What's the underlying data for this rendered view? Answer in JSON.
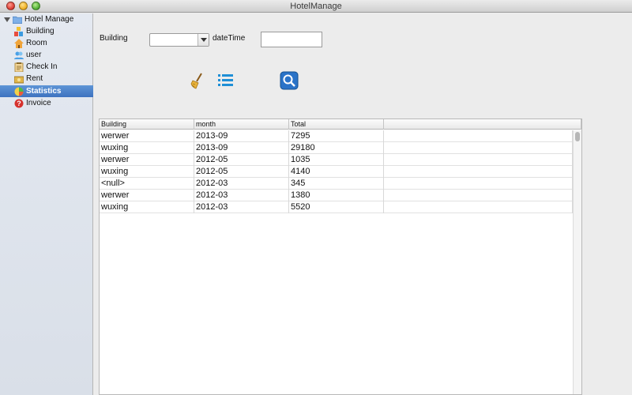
{
  "window": {
    "title": "HotelManage"
  },
  "sidebar": {
    "root": {
      "label": "Hotel Manage",
      "icon": "folder-icon"
    },
    "items": [
      {
        "label": "Building",
        "icon": "building-blocks-icon"
      },
      {
        "label": "Room",
        "icon": "house-icon"
      },
      {
        "label": "user",
        "icon": "users-icon"
      },
      {
        "label": "Check In",
        "icon": "clipboard-icon"
      },
      {
        "label": "Rent",
        "icon": "money-icon"
      },
      {
        "label": "Statistics",
        "icon": "pie-chart-icon",
        "selected": true
      },
      {
        "label": "Invoice",
        "icon": "help-icon"
      }
    ]
  },
  "form": {
    "building_label": "Building",
    "building_value": "",
    "datetime_label": "dateTime",
    "datetime_value": ""
  },
  "toolbar": {
    "clear_icon": "broom-icon",
    "list_icon": "list-icon",
    "search_icon": "magnifier-icon"
  },
  "table": {
    "columns": [
      "Building",
      "month",
      "Total"
    ],
    "rows": [
      [
        "werwer",
        "2013-09",
        "7295"
      ],
      [
        "wuxing",
        "2013-09",
        "29180"
      ],
      [
        "werwer",
        "2012-05",
        "1035"
      ],
      [
        "wuxing",
        "2012-05",
        "4140"
      ],
      [
        "<null>",
        "2012-03",
        "345"
      ],
      [
        "werwer",
        "2012-03",
        "1380"
      ],
      [
        "wuxing",
        "2012-03",
        "5520"
      ]
    ]
  },
  "colors": {
    "selection": "#3e73c0",
    "list_icon": "#1f8fd6",
    "search_button": "#2a73c8"
  }
}
